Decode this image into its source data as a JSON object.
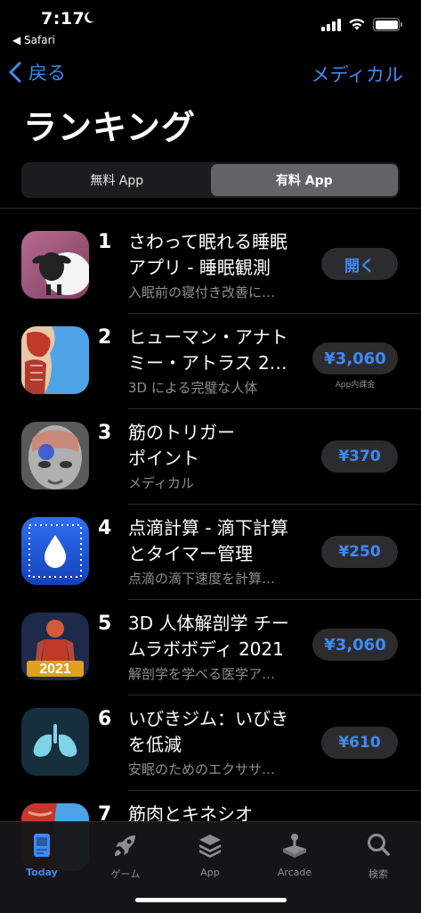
{
  "status_bar": {
    "time": "7:17",
    "back_app": "◀ Safari"
  },
  "nav": {
    "back_label": "戻る",
    "right_label": "メディカル"
  },
  "page_title": "ランキング",
  "segmented": {
    "free": "無料 App",
    "paid": "有料 App",
    "selected": "paid"
  },
  "apps": [
    {
      "rank": "1",
      "title_line1": "さわって眠れる睡眠",
      "title_line2": "アプリ - 睡眠観測",
      "subtitle": "入眠前の寝付き改善に…",
      "button": "開く",
      "iap": "",
      "icon": "sheep-icon"
    },
    {
      "rank": "2",
      "title_line1": "ヒューマン・アナト",
      "title_line2": "ミー・アトラス 2…",
      "subtitle": "3D による完璧な人体",
      "button": "¥3,060",
      "iap": "App内課金",
      "icon": "anatomy-atlas-icon"
    },
    {
      "rank": "3",
      "title_line1": "筋のトリガー",
      "title_line2": "ポイント",
      "subtitle": "メディカル",
      "button": "¥370",
      "iap": "",
      "icon": "trigger-point-icon"
    },
    {
      "rank": "4",
      "title_line1": "点滴計算 - 滴下計算",
      "title_line2": "とタイマー管理",
      "subtitle": "点滴の滴下速度を計算…",
      "button": "¥250",
      "iap": "",
      "icon": "drip-icon"
    },
    {
      "rank": "5",
      "title_line1": "3D 人体解剖学 チー",
      "title_line2": "ムラボボディ 2021",
      "subtitle": "解剖学を学べる医学ア…",
      "button": "¥3,060",
      "iap": "",
      "icon": "anatomy-2021-icon"
    },
    {
      "rank": "6",
      "title_line1": "いびきジム：いびき",
      "title_line2": "を低減",
      "subtitle": "安眠のためのエクササ…",
      "button": "¥610",
      "iap": "",
      "icon": "lungs-icon"
    },
    {
      "rank": "7",
      "title_line1": "筋肉とキネシオ",
      "title_line2": "",
      "subtitle": "",
      "button": "",
      "iap": "",
      "icon": "muscle-icon"
    }
  ],
  "icon_2021_text": "2021",
  "tabs": [
    {
      "label": "Today",
      "icon": "today-icon",
      "active": true
    },
    {
      "label": "ゲーム",
      "icon": "rocket-icon",
      "active": false
    },
    {
      "label": "App",
      "icon": "layers-icon",
      "active": false
    },
    {
      "label": "Arcade",
      "icon": "joystick-icon",
      "active": false
    },
    {
      "label": "検索",
      "icon": "search-icon",
      "active": false
    }
  ],
  "colors": {
    "accent": "#3d8bf5",
    "background": "#000000",
    "secondary_text": "#8d8d93",
    "button_bg": "#2c2c2e"
  }
}
